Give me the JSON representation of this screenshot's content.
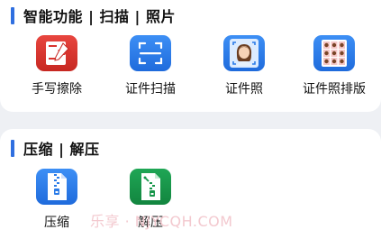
{
  "sections": [
    {
      "title": "智能功能 | 扫描 | 照片",
      "tools": [
        {
          "label": "手写擦除",
          "icon": "handwriting-erase-icon"
        },
        {
          "label": "证件扫描",
          "icon": "scan-frame-icon"
        },
        {
          "label": "证件照",
          "icon": "id-photo-portrait-icon"
        },
        {
          "label": "证件照排版",
          "icon": "id-photo-layout-icon"
        }
      ]
    },
    {
      "title": "压缩 | 解压",
      "tools": [
        {
          "label": "压缩",
          "icon": "zip-compress-icon"
        },
        {
          "label": "解压",
          "icon": "unzip-extract-icon"
        }
      ]
    }
  ],
  "watermark": "乐享 · NJYCQH.COM",
  "colors": {
    "accent": "#2f6fe0",
    "red_icon": "#d9332d",
    "blue_icon": "#2a7be8",
    "green_icon": "#17964a"
  }
}
